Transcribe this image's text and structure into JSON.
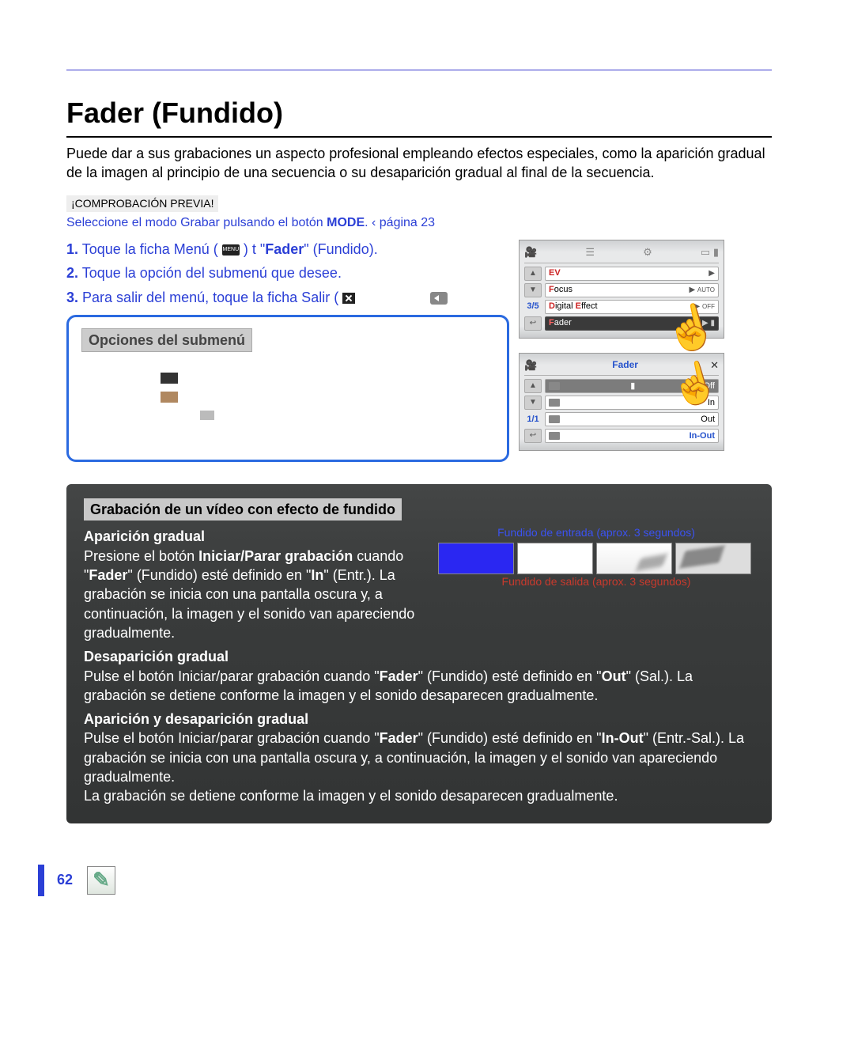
{
  "title": "Fader (Fundido)",
  "intro": "Puede dar a sus grabaciones un aspecto profesional empleando efectos especiales, como la aparición gradual de la imagen al principio de una secuencia o su desaparición gradual al final de la secuencia.",
  "precheck": {
    "label": "¡COMPROBACIÓN PREVIA!",
    "text_a": "Seleccione el modo Grabar pulsando el botón ",
    "text_b": "MODE",
    "text_c": ".  ‹ página 23"
  },
  "steps": {
    "s1a": "Toque la ficha Menú (",
    "s1b": ")  t  \"",
    "s1c": "Fader",
    "s1d": "\" (Fundido).",
    "s2": "Toque la opción del submenú que desee.",
    "s3a": "Para salir del menú, toque la ficha Salir (",
    "s3b": ""
  },
  "screen1": {
    "pager": "3/5",
    "items": {
      "ev": "EV",
      "focus": "Focus",
      "de_a": "D",
      "de_b": "igital ",
      "de_c": "E",
      "de_d": "ffect",
      "fader_a": "F",
      "fader_b": "ader"
    },
    "rt": {
      "auto": "AUTO",
      "off": "OFF"
    }
  },
  "screen2": {
    "title": "Fader",
    "pager": "1/1",
    "items": {
      "off": "Off",
      "in": "In",
      "out": "Out",
      "inout": "In-Out"
    }
  },
  "options_title": "Opciones del submenú",
  "panel": {
    "title": "Grabación de un vídeo con efecto de fundido",
    "h1": "Aparición gradual",
    "p1a": "Presione el botón ",
    "p1b": "Iniciar/Parar grabación",
    "p1c": " cuando \"",
    "p1d": "Fader",
    "p1e": "\" (Fundido) esté definido en \"",
    "p1f": "In",
    "p1g": "\" (Entr.). La grabación se inicia con una pantalla oscura y, a continuación, la imagen y el sonido van apareciendo gradualmente.",
    "cap_in": "Fundido de entrada (aprox. 3 segundos)",
    "cap_out": "Fundido de salida (aprox. 3 segundos)",
    "h2": "Desaparición gradual",
    "p2a": "Pulse el botón Iniciar/parar grabación cuando \"",
    "p2b": "Fader",
    "p2c": "\" (Fundido) esté definido en \"",
    "p2d": "Out",
    "p2e": "\" (Sal.). La grabación se detiene conforme la imagen y el sonido desaparecen gradualmente.",
    "h3": "Aparición y desaparición gradual",
    "p3a": "Pulse el botón Iniciar/parar grabación cuando \"",
    "p3b": "Fader",
    "p3c": "\" (Fundido) esté definido en \"",
    "p3d": "In-Out",
    "p3e": "\" (Entr.-Sal.). La grabación se inicia con una pantalla oscura y, a continuación, la imagen y el sonido van apareciendo gradualmente.",
    "p3f": "La grabación se detiene conforme la imagen y el sonido desaparecen gradualmente."
  },
  "page_number": "62"
}
